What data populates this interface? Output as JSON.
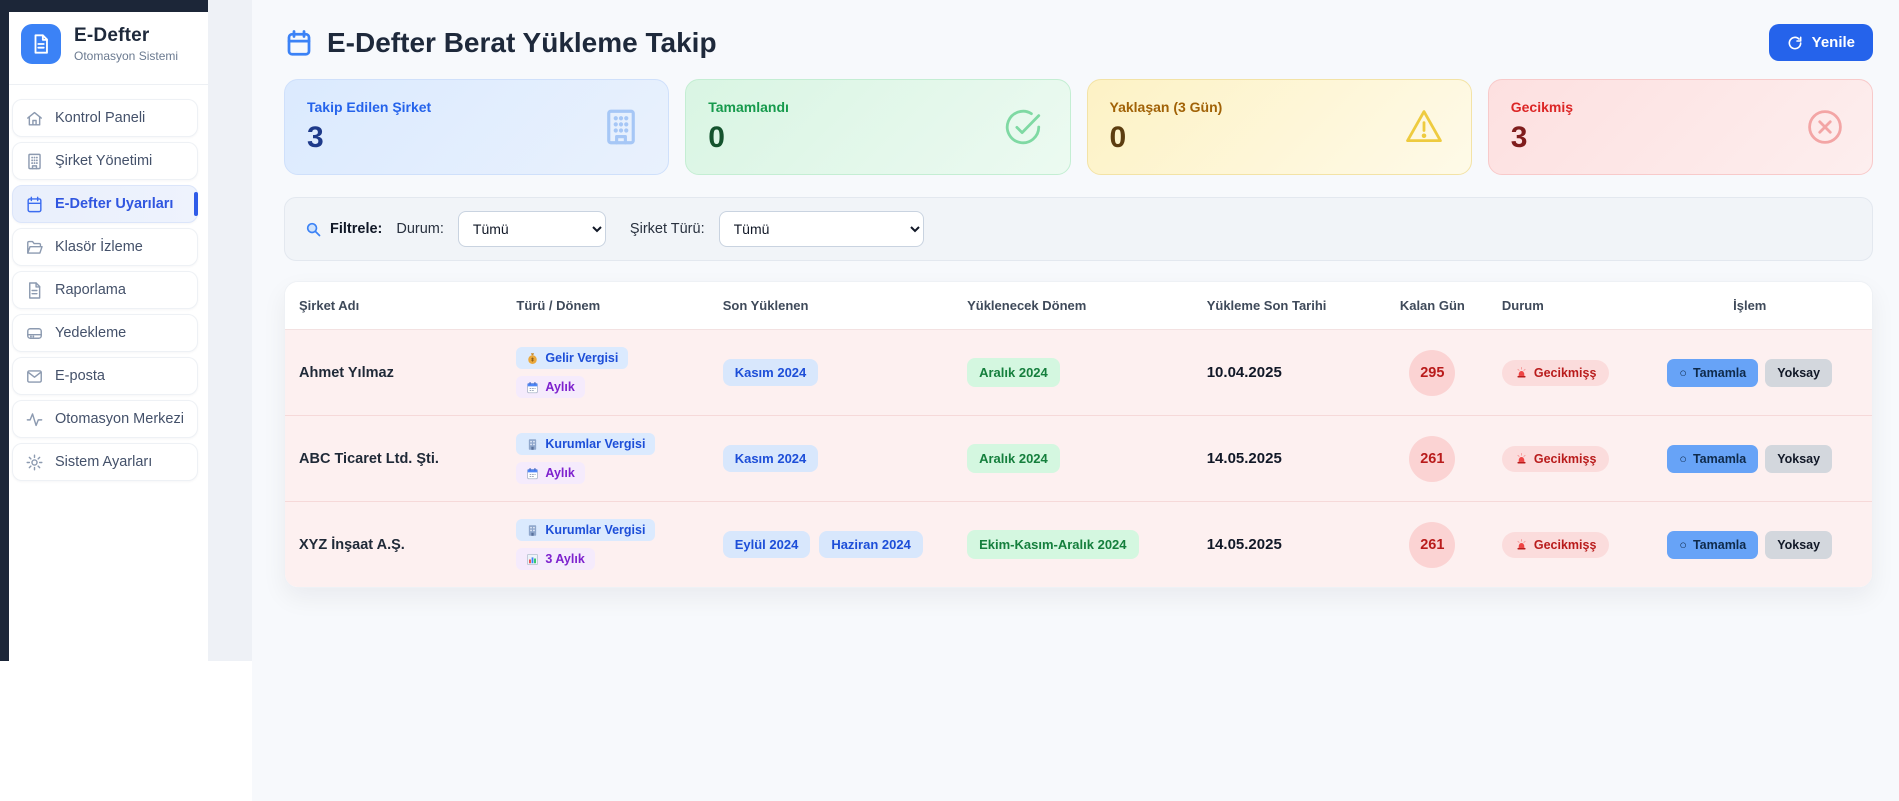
{
  "sidebar": {
    "app_title": "E-Defter",
    "app_subtitle": "Otomasyon Sistemi",
    "items": [
      {
        "id": "kontrol-paneli",
        "label": "Kontrol Paneli",
        "icon": "home-icon",
        "active": false
      },
      {
        "id": "sirket-yonetimi",
        "label": "Şirket Yönetimi",
        "icon": "building-icon",
        "active": false
      },
      {
        "id": "edefter-uyarilari",
        "label": "E-Defter Uyarıları",
        "icon": "calendar-icon",
        "active": true
      },
      {
        "id": "klasor-izleme",
        "label": "Klasör İzleme",
        "icon": "folder-icon",
        "active": false
      },
      {
        "id": "raporlama",
        "label": "Raporlama",
        "icon": "report-icon",
        "active": false
      },
      {
        "id": "yedekleme",
        "label": "Yedekleme",
        "icon": "backup-icon",
        "active": false
      },
      {
        "id": "e-posta",
        "label": "E-posta",
        "icon": "mail-icon",
        "active": false
      },
      {
        "id": "otomasyon-merkezi",
        "label": "Otomasyon Merkezi",
        "icon": "activity-icon",
        "active": false
      },
      {
        "id": "sistem-ayarlari",
        "label": "Sistem Ayarları",
        "icon": "gear-icon",
        "active": false
      }
    ]
  },
  "header": {
    "title": "E-Defter Berat Yükleme Takip",
    "title_icon": "calendar-icon",
    "refresh_label": "Yenile",
    "refresh_icon": "refresh-icon"
  },
  "stats": [
    {
      "id": "takip-edilen-sirket",
      "label": "Takip Edilen Şirket",
      "value": "3",
      "icon": "building-icon",
      "theme": "blue"
    },
    {
      "id": "tamamlandi",
      "label": "Tamamlandı",
      "value": "0",
      "icon": "check-circle-icon",
      "theme": "green"
    },
    {
      "id": "yaklasan",
      "label": "Yaklaşan (3 Gün)",
      "value": "0",
      "icon": "warning-triangle-icon",
      "theme": "yellow"
    },
    {
      "id": "gecikmis",
      "label": "Gecikmiş",
      "value": "3",
      "icon": "x-circle-icon",
      "theme": "red"
    }
  ],
  "filters": {
    "icon": "magnifier-icon",
    "label": "Filtrele:",
    "status_label": "Durum:",
    "status_value": "Tümü",
    "company_type_label": "Şirket Türü:",
    "company_type_value": "Tümü"
  },
  "table": {
    "columns": [
      "Şirket Adı",
      "Türü / Dönem",
      "Son Yüklenen",
      "Yüklenecek Dönem",
      "Yükleme Son Tarihi",
      "Kalan Gün",
      "Durum",
      "İşlem"
    ],
    "actions": {
      "complete_label": "Tamamla",
      "complete_icon": "circle-icon",
      "ignore_label": "Yoksay"
    },
    "rows": [
      {
        "company": "Ahmet Yılmaz",
        "tax_type": {
          "icon": "money-bag-icon",
          "label": "Gelir Vergisi"
        },
        "period_type": {
          "icon": "calendar-page-icon",
          "label": "Aylık"
        },
        "last_uploaded": [
          "Kasım 2024"
        ],
        "next_period": "Aralık 2024",
        "deadline": "10.04.2025",
        "days_left": "295",
        "status": {
          "icon": "siren-icon",
          "label": "Gecikmişş"
        }
      },
      {
        "company": "ABC Ticaret Ltd. Şti.",
        "tax_type": {
          "icon": "office-building-icon",
          "label": "Kurumlar Vergisi"
        },
        "period_type": {
          "icon": "calendar-page-icon",
          "label": "Aylık"
        },
        "last_uploaded": [
          "Kasım 2024"
        ],
        "next_period": "Aralık 2024",
        "deadline": "14.05.2025",
        "days_left": "261",
        "status": {
          "icon": "siren-icon",
          "label": "Gecikmişş"
        }
      },
      {
        "company": "XYZ İnşaat A.Ş.",
        "tax_type": {
          "icon": "office-building-icon",
          "label": "Kurumlar Vergisi"
        },
        "period_type": {
          "icon": "bar-chart-icon",
          "label": "3 Aylık"
        },
        "last_uploaded": [
          "Eylül 2024",
          "Haziran 2024"
        ],
        "next_period": "Ekim-Kasım-Aralık 2024",
        "deadline": "14.05.2025",
        "days_left": "261",
        "status": {
          "icon": "siren-icon",
          "label": "Gecikmişş"
        }
      }
    ]
  },
  "colors": {
    "accent": "#2563eb",
    "sidebar_active": "#3056e0",
    "danger_text": "#b91c1c",
    "success_text": "#157f3d",
    "row_background": "#fdf0f0",
    "dark_edge": "#1c2638"
  }
}
